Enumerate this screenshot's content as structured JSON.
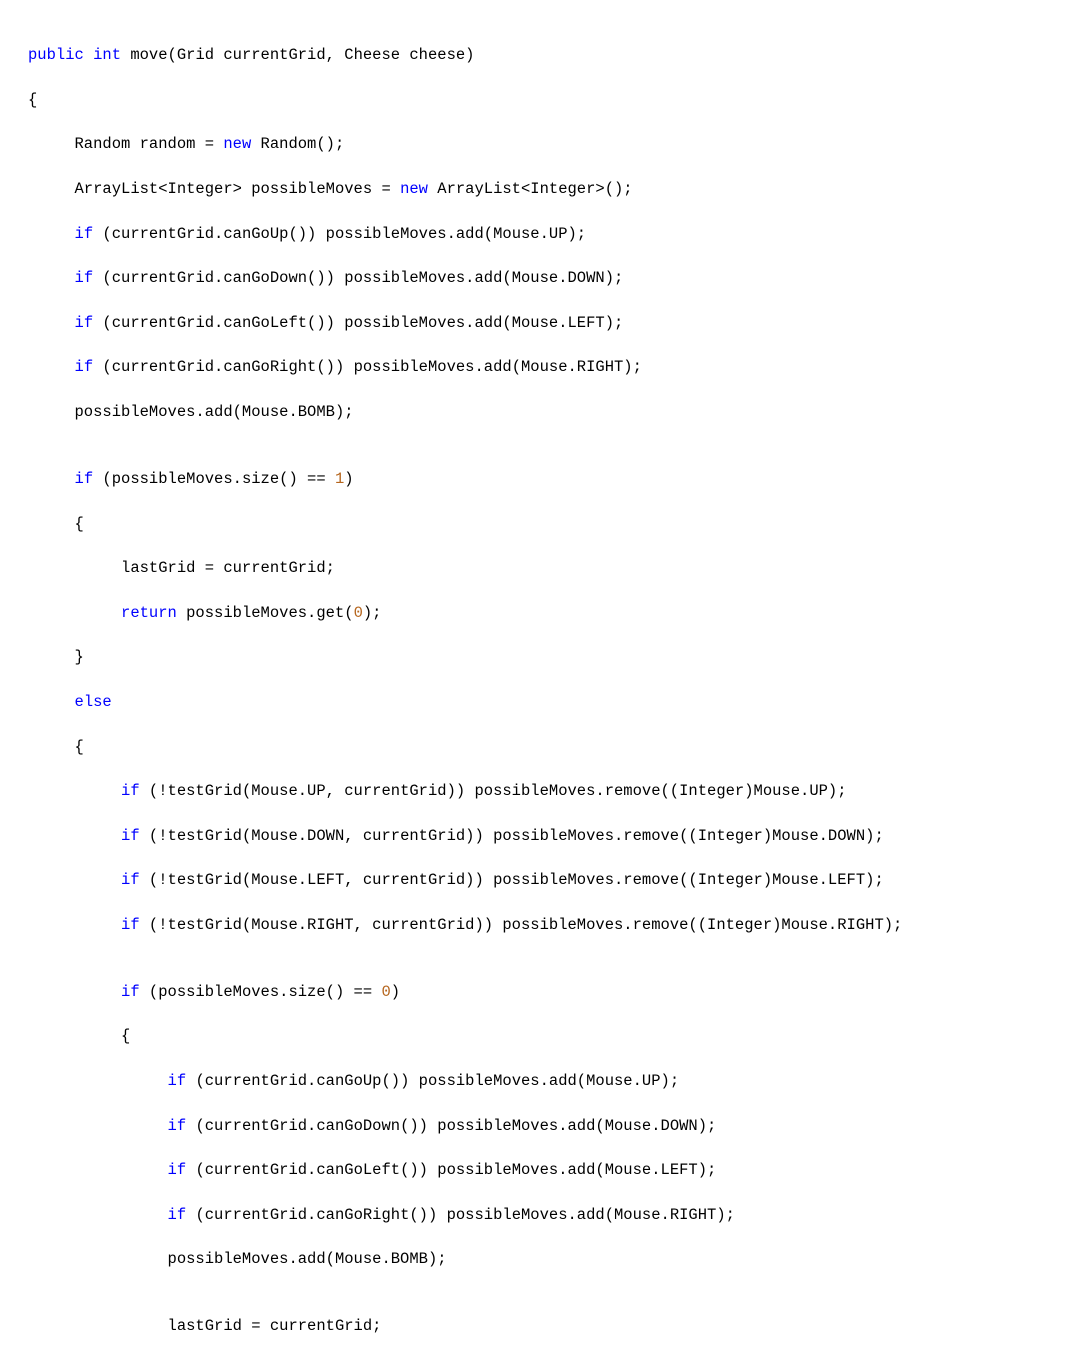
{
  "code": {
    "l1": {
      "t1": "public",
      "s1": " ",
      "t2": "int",
      "s2": " move(Grid currentGrid, Cheese cheese)"
    },
    "l2": "{",
    "l3": {
      "s1": "     Random random = ",
      "t1": "new",
      "s2": " Random();"
    },
    "l4": {
      "s1": "     ArrayList<Integer> possibleMoves = ",
      "t1": "new",
      "s2": " ArrayList<Integer>();"
    },
    "l5": {
      "t1": "if",
      "s1": " (currentGrid.canGoUp()) possibleMoves.add(Mouse.UP);"
    },
    "l6": {
      "t1": "if",
      "s1": " (currentGrid.canGoDown()) possibleMoves.add(Mouse.DOWN);"
    },
    "l7": {
      "t1": "if",
      "s1": " (currentGrid.canGoLeft()) possibleMoves.add(Mouse.LEFT);"
    },
    "l8": {
      "t1": "if",
      "s1": " (currentGrid.canGoRight()) possibleMoves.add(Mouse.RIGHT);"
    },
    "l9": "     possibleMoves.add(Mouse.BOMB);",
    "l10": "",
    "l11": {
      "t1": "if",
      "s1": " (possibleMoves.size() == ",
      "n1": "1",
      "s2": ")"
    },
    "l12": "     {",
    "l13": "          lastGrid = currentGrid;",
    "l14": {
      "t1": "return",
      "s1": " possibleMoves.get(",
      "n1": "0",
      "s2": ");"
    },
    "l15": "     }",
    "l16": {
      "t1": "else"
    },
    "l17": "     {",
    "l18": {
      "t1": "if",
      "s1": " (!testGrid(Mouse.UP, currentGrid)) possibleMoves.remove((Integer)Mouse.UP);"
    },
    "l19": {
      "t1": "if",
      "s1": " (!testGrid(Mouse.DOWN, currentGrid)) possibleMoves.remove((Integer)Mouse.DOWN);"
    },
    "l20": {
      "t1": "if",
      "s1": " (!testGrid(Mouse.LEFT, currentGrid)) possibleMoves.remove((Integer)Mouse.LEFT);"
    },
    "l21": {
      "t1": "if",
      "s1": " (!testGrid(Mouse.RIGHT, currentGrid)) possibleMoves.remove((Integer)Mouse.RIGHT);"
    },
    "l22": "",
    "l23": {
      "t1": "if",
      "s1": " (possibleMoves.size() == ",
      "n1": "0",
      "s2": ")"
    },
    "l24": "          {",
    "l25": {
      "t1": "if",
      "s1": " (currentGrid.canGoUp()) possibleMoves.add(Mouse.UP);"
    },
    "l26": {
      "t1": "if",
      "s1": " (currentGrid.canGoDown()) possibleMoves.add(Mouse.DOWN);"
    },
    "l27": {
      "t1": "if",
      "s1": " (currentGrid.canGoLeft()) possibleMoves.add(Mouse.LEFT);"
    },
    "l28": {
      "t1": "if",
      "s1": " (currentGrid.canGoRight()) possibleMoves.add(Mouse.RIGHT);"
    },
    "l29": "               possibleMoves.add(Mouse.BOMB);",
    "l30": "",
    "l31": "               lastGrid = currentGrid;"
  }
}
